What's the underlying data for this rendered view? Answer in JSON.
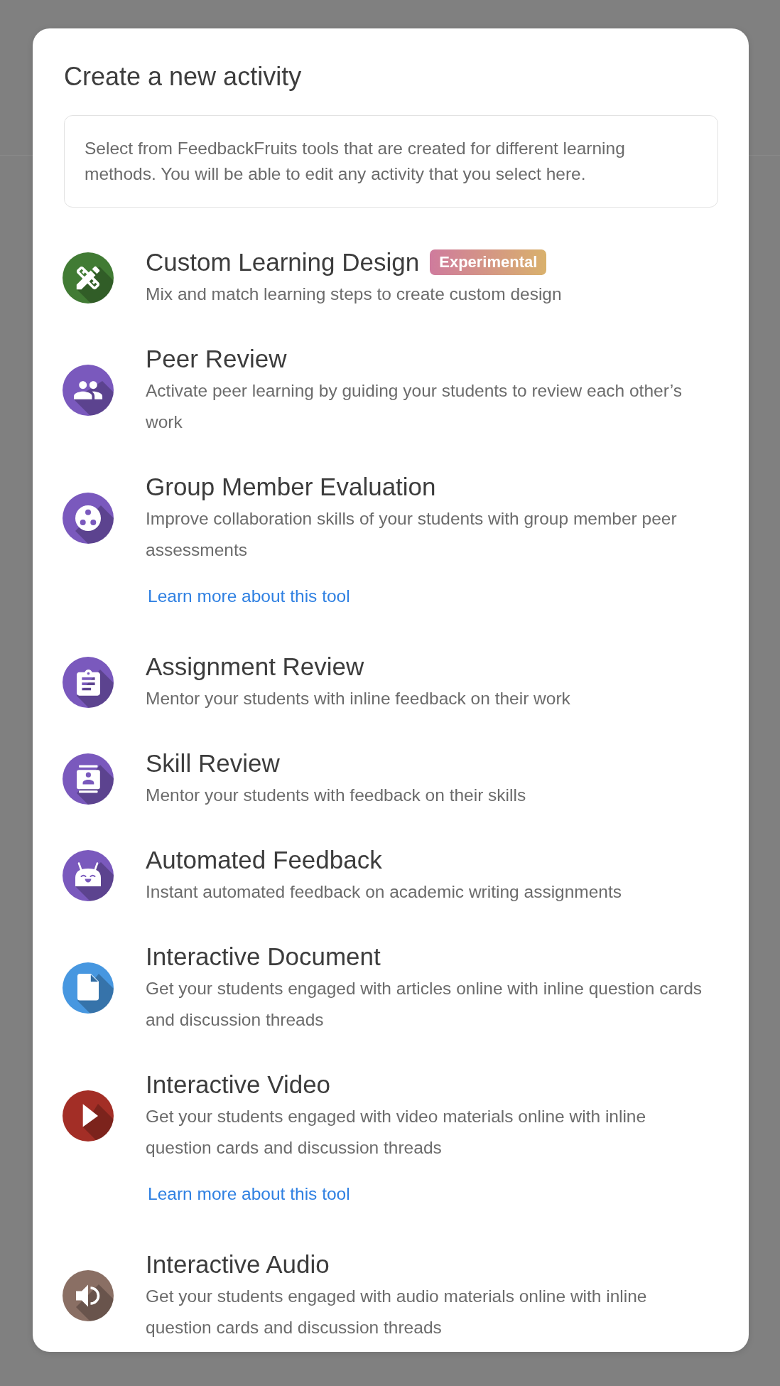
{
  "dialog": {
    "title": "Create a new activity",
    "intro": "Select from FeedbackFruits tools that are created for different learning methods. You will be able to edit any activity that you select here."
  },
  "activities": [
    {
      "title": "Custom Learning Design",
      "badge": "Experimental",
      "description": "Mix and match learning steps to create custom design",
      "color": "#417b34"
    },
    {
      "title": "Peer Review",
      "description": "Activate peer learning by guiding your students to review each other’s work",
      "color": "#7a59bd"
    },
    {
      "title": "Group Member Evaluation",
      "description": "Improve collaboration skills of your students with group member peer assessments",
      "link": "Learn more about this tool",
      "color": "#7a59bd"
    },
    {
      "title": "Assignment Review",
      "description": "Mentor your students with inline feedback on their work",
      "color": "#7a59bd"
    },
    {
      "title": "Skill Review",
      "description": "Mentor your students with feedback on their skills",
      "color": "#7a59bd"
    },
    {
      "title": "Automated Feedback",
      "description": "Instant automated feedback on academic writing assignments",
      "color": "#7a59bd"
    },
    {
      "title": "Interactive Document",
      "description": "Get your students engaged with articles online with inline question cards and discussion threads",
      "color": "#4797e0"
    },
    {
      "title": "Interactive Video",
      "description": "Get your students engaged with video materials online with inline question cards and discussion threads",
      "link": "Learn more about this tool",
      "color": "#a32e26"
    },
    {
      "title": "Interactive Audio",
      "description": "Get your students engaged with audio materials online with inline question cards and discussion threads",
      "color": "#8a6f64"
    }
  ]
}
